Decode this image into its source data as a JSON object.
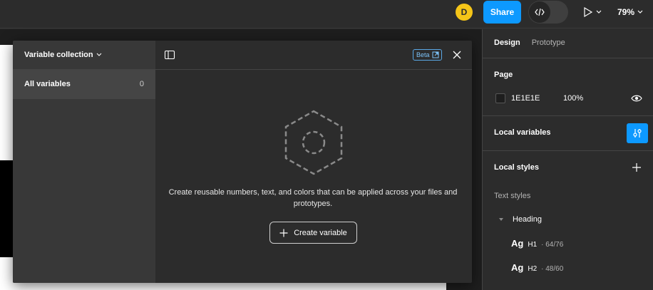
{
  "toolbar": {
    "avatar_initial": "D",
    "share_label": "Share",
    "zoom_label": "79%"
  },
  "modal": {
    "collection_label": "Variable collection",
    "sidebar_item": {
      "label": "All variables",
      "count": "0"
    },
    "beta_label": "Beta",
    "empty_message": "Create reusable numbers, text, and colors that can be applied across your files and prototypes.",
    "create_button_label": "Create variable"
  },
  "right_panel": {
    "tabs": [
      {
        "label": "Design",
        "active": true
      },
      {
        "label": "Prototype",
        "active": false
      }
    ],
    "page": {
      "title": "Page",
      "color_hex": "1E1E1E",
      "opacity": "100%"
    },
    "local_variables_title": "Local variables",
    "local_styles_title": "Local styles",
    "text_styles_label": "Text styles",
    "heading_group_label": "Heading",
    "text_styles": [
      {
        "preview": "Ag",
        "name": "H1",
        "size": "· 64/76"
      },
      {
        "preview": "Ag",
        "name": "H2",
        "size": "· 48/60"
      }
    ]
  },
  "colors": {
    "accent": "#0d99ff",
    "avatar": "#f5c518",
    "panel_bg": "#2c2c2c",
    "canvas_bg": "#1e1e1e"
  },
  "icons": [
    "code-icon",
    "play-icon",
    "chevron-down-icon",
    "panel-toggle-icon",
    "external-link-icon",
    "close-icon",
    "hexagon-variable-icon",
    "plus-icon",
    "eye-icon",
    "adjust-icon",
    "caret-down-icon"
  ]
}
